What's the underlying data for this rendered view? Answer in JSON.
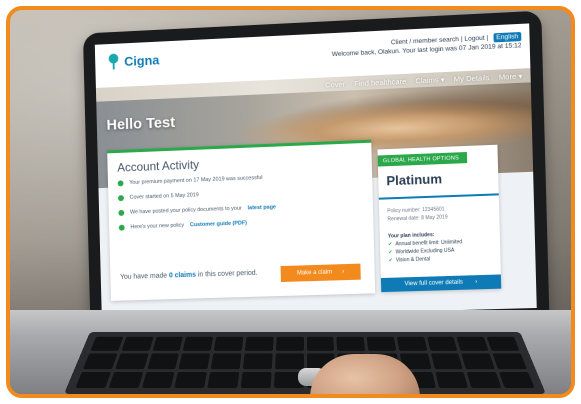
{
  "brand": {
    "logo_text": "Cigna",
    "accent": "#0f7bb6",
    "green": "#2aa84a",
    "orange": "#f28a1e",
    "frame_color": "#f28a1e"
  },
  "topbar": {
    "util_links": "Client / member search  |  Logout  |",
    "language": "English",
    "welcome": "Welcome back, Olakun. Your last login was 07 Jan 2019 at 15:12"
  },
  "nav": {
    "items": [
      "Cover",
      "Find healthcare",
      "Claims ▾",
      "My Details",
      "More ▾"
    ]
  },
  "hero": {
    "greeting": "Hello Test"
  },
  "activity": {
    "title": "Account Activity",
    "items": [
      {
        "text": "Your premium payment on 17 May 2019 was successful"
      },
      {
        "text": "Cover started on 5 May 2019"
      },
      {
        "text": "We have posted your policy documents to your",
        "link": "latest page"
      },
      {
        "text": "Here's your new policy",
        "link": "Customer guide (PDF)"
      }
    ],
    "claims_prefix": "You have made",
    "claims_count": "0 claims",
    "claims_suffix": "in this cover period.",
    "make_claim_button": "Make a claim",
    "arrow": "›"
  },
  "plan": {
    "ribbon": "GLOBAL HEALTH OPTIONS",
    "name": "Platinum",
    "policy_number": "Policy number: 12345601",
    "renewal": "Renewal date: 8 May 2019",
    "includes_title": "Your plan includes:",
    "includes": [
      "Annual benefit limit: Unlimited",
      "Worldwide Excluding USA",
      "Vision & Dental"
    ],
    "check": "✔",
    "view_button": "View full cover details",
    "arrow": "›"
  }
}
